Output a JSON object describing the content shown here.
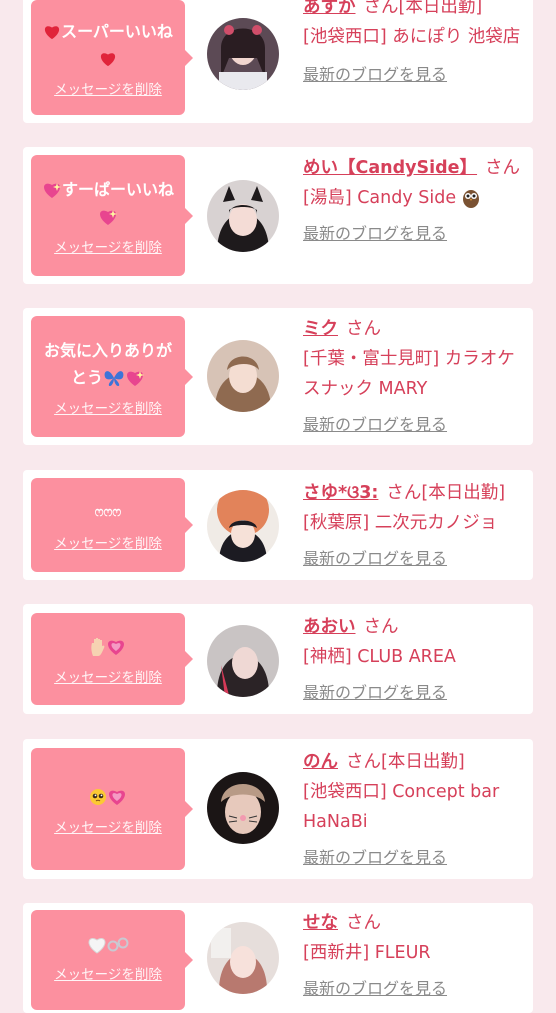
{
  "colors": {
    "accent": "#d6405a",
    "bubble": "#fc909f",
    "background": "#f9e9ed",
    "muted": "#8a8a8a"
  },
  "delete_label": "メッセージを削除",
  "blog_label": "最新のブログを見る",
  "items": [
    {
      "message_prefix": "",
      "message": "スーパーいいね",
      "message_suffix": "",
      "name": "あすか",
      "honorific": "さん",
      "status": "[本日出勤]",
      "shop": "[池袋西口] あにぽり 池袋店",
      "icons": [
        "red-heart",
        "red-heart"
      ]
    },
    {
      "message_prefix": "",
      "message": "すーぱーいいね",
      "message_suffix": "",
      "name": "めい【CandySide】",
      "honorific": "さん",
      "status": "",
      "shop": "[湯島] Candy Side",
      "icons": [
        "sparkling-heart",
        "sparkling-heart",
        "owl"
      ]
    },
    {
      "message_prefix": "",
      "message": "お気に入りありがとう",
      "message_suffix": "",
      "name": "ミク",
      "honorific": "さん",
      "status": "",
      "shop": "[千葉・富士見町] カラオケスナック MARY",
      "icons": [
        "butterfly",
        "sparkling-heart"
      ]
    },
    {
      "message_prefix": "",
      "message": "ෆෆෆ",
      "message_suffix": "",
      "name": "さゆ*ଓ3:",
      "honorific": "さん",
      "status": "[本日出勤]",
      "shop": "[秋葉原] 二次元カノジョ",
      "icons": []
    },
    {
      "message_prefix": "",
      "message": "",
      "message_suffix": "",
      "name": "あおい",
      "honorific": "さん",
      "status": "",
      "shop": "[神栖] CLUB AREA",
      "icons": [
        "raised-hand",
        "growing-heart"
      ]
    },
    {
      "message_prefix": "",
      "message": "",
      "message_suffix": "",
      "name": "のん",
      "honorific": "さん",
      "status": "[本日出勤]",
      "shop": "[池袋西口] Concept bar HaNaBi",
      "icons": [
        "pleading-face",
        "growing-heart"
      ]
    },
    {
      "message_prefix": "",
      "message": "",
      "message_suffix": "",
      "name": "せな",
      "honorific": "さん",
      "status": "",
      "shop": "[西新井] FLEUR",
      "icons": [
        "white-heart",
        "handcuffs"
      ]
    }
  ]
}
